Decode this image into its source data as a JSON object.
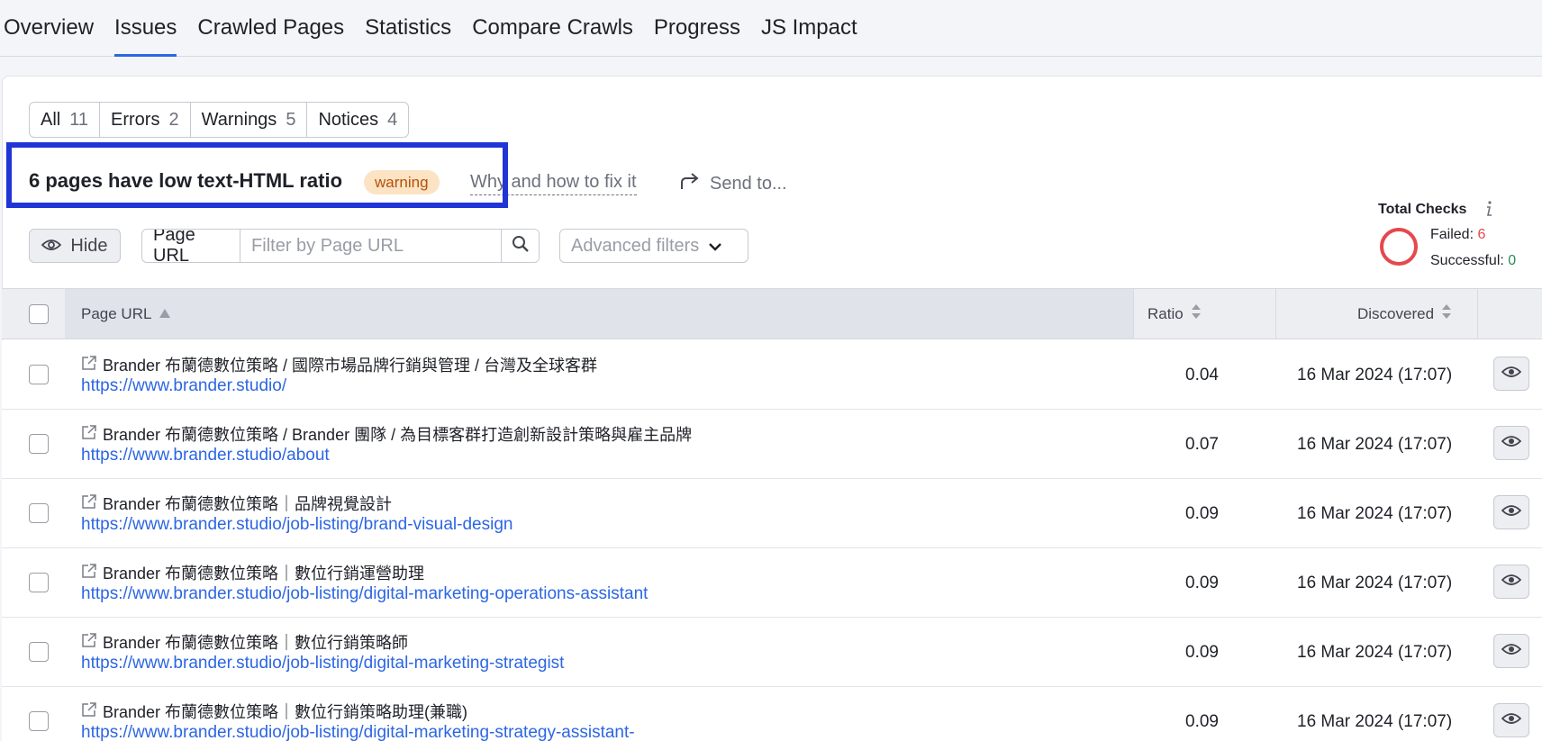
{
  "nav": {
    "tabs": [
      {
        "label": "Overview"
      },
      {
        "label": "Issues"
      },
      {
        "label": "Crawled Pages"
      },
      {
        "label": "Statistics"
      },
      {
        "label": "Compare Crawls"
      },
      {
        "label": "Progress"
      },
      {
        "label": "JS Impact"
      }
    ],
    "active": "Issues"
  },
  "filters": {
    "all": {
      "label": "All",
      "count": "11"
    },
    "errors": {
      "label": "Errors",
      "count": "2"
    },
    "warnings": {
      "label": "Warnings",
      "count": "5"
    },
    "notices": {
      "label": "Notices",
      "count": "4"
    }
  },
  "issue": {
    "title": "6 pages have low text-HTML ratio",
    "badge": "warning",
    "why_link": "Why and how to fix it",
    "send_to": "Send to..."
  },
  "controls": {
    "hide_label": "Hide",
    "url_filter_label": "Page URL",
    "url_filter_placeholder": "Filter by Page URL",
    "advanced_filters": "Advanced filters"
  },
  "total_checks": {
    "title": "Total Checks",
    "failed_label": "Failed:",
    "failed_value": "6",
    "success_label": "Successful:",
    "success_value": "0"
  },
  "table": {
    "headers": {
      "url": "Page URL",
      "ratio": "Ratio",
      "discovered": "Discovered"
    },
    "rows": [
      {
        "title": "Brander 布蘭德數位策略 / 國際市場品牌行銷與管理 / 台灣及全球客群",
        "url": "https://www.brander.studio/",
        "ratio": "0.04",
        "discovered": "16 Mar 2024 (17:07)"
      },
      {
        "title": "Brander 布蘭德數位策略 / Brander 團隊 / 為目標客群打造創新設計策略與雇主品牌",
        "url": "https://www.brander.studio/about",
        "ratio": "0.07",
        "discovered": "16 Mar 2024 (17:07)"
      },
      {
        "title": "Brander 布蘭德數位策略｜品牌視覺設計",
        "url": "https://www.brander.studio/job-listing/brand-visual-design",
        "ratio": "0.09",
        "discovered": "16 Mar 2024 (17:07)"
      },
      {
        "title": "Brander 布蘭德數位策略｜數位行銷運營助理",
        "url": "https://www.brander.studio/job-listing/digital-marketing-operations-assistant",
        "ratio": "0.09",
        "discovered": "16 Mar 2024 (17:07)"
      },
      {
        "title": "Brander 布蘭德數位策略｜數位行銷策略師",
        "url": "https://www.brander.studio/job-listing/digital-marketing-strategist",
        "ratio": "0.09",
        "discovered": "16 Mar 2024 (17:07)"
      },
      {
        "title": "Brander 布蘭德數位策略｜數位行銷策略助理(兼職)",
        "url": "https://www.brander.studio/job-listing/digital-marketing-strategy-assistant-",
        "ratio": "0.09",
        "discovered": "16 Mar 2024 (17:07)"
      }
    ]
  },
  "colors": {
    "accent": "#2c66e4",
    "warning_bg": "#fbe3c4",
    "warning_text": "#b3520c",
    "failed": "#e5484d",
    "highlight": "#1f35d6"
  }
}
